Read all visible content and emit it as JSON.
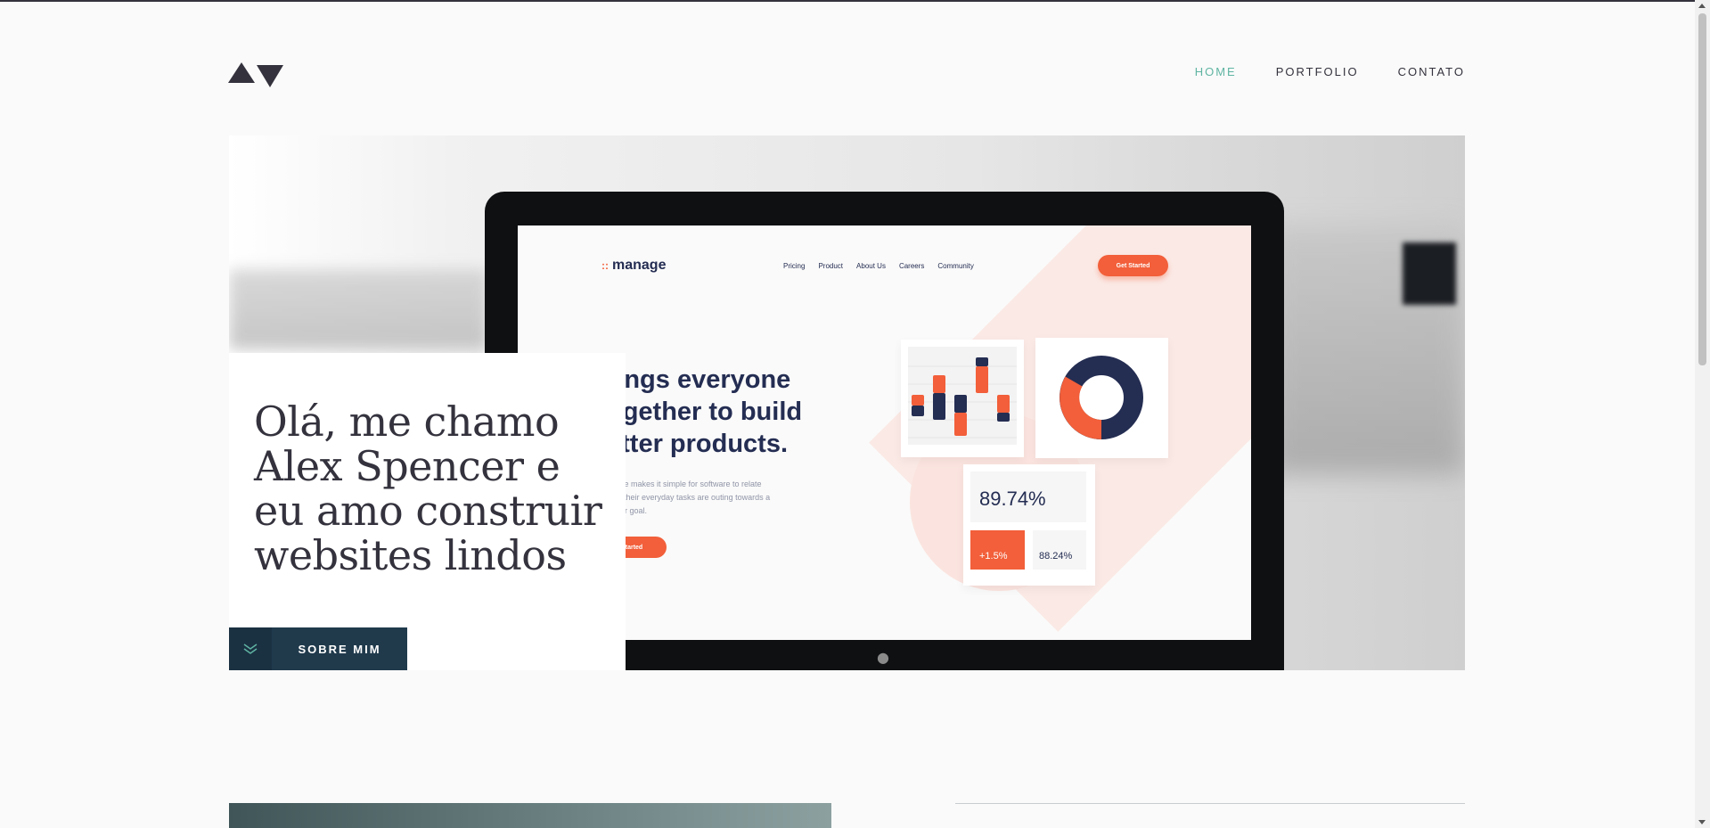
{
  "header": {
    "nav": [
      {
        "label": "HOME",
        "active": true
      },
      {
        "label": "PORTFOLIO",
        "active": false
      },
      {
        "label": "CONTATO",
        "active": false
      }
    ]
  },
  "hero": {
    "heading": "Olá, me chamo Alex Spencer e eu amo construir websites lindos",
    "about_button": "SOBRE MIM",
    "screen": {
      "brand": "manage",
      "nav": [
        "Pricing",
        "Product",
        "About Us",
        "Careers",
        "Community"
      ],
      "nav_button": "Get Started",
      "headline": "rings everyone ogether to build etter products.",
      "subtext": "ftware makes it simple for software to relate how their everyday tasks are outing towards a larger goal.",
      "cta": "t Started",
      "stat_main": "89.74%",
      "stat_change": "+1.5%",
      "stat_secondary": "88.24%"
    }
  },
  "colors": {
    "accent": "#5fb4a2",
    "dark": "#33323d",
    "button": "#203a4c",
    "orange": "#f25f3a",
    "navy": "#242d52"
  }
}
